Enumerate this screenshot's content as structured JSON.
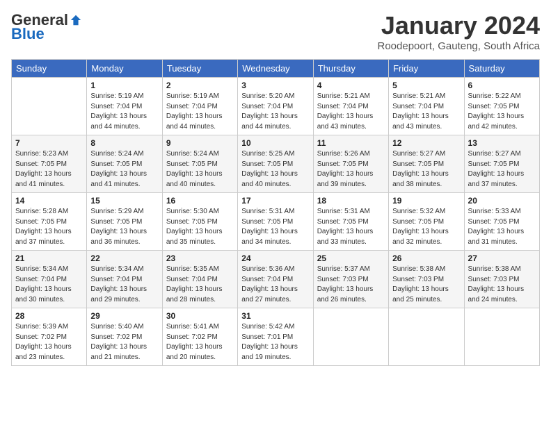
{
  "header": {
    "logo": {
      "general": "General",
      "blue": "Blue"
    },
    "title": "January 2024",
    "location": "Roodepoort, Gauteng, South Africa"
  },
  "weekdays": [
    "Sunday",
    "Monday",
    "Tuesday",
    "Wednesday",
    "Thursday",
    "Friday",
    "Saturday"
  ],
  "weeks": [
    [
      {
        "day": "",
        "info": ""
      },
      {
        "day": "1",
        "info": "Sunrise: 5:19 AM\nSunset: 7:04 PM\nDaylight: 13 hours\nand 44 minutes."
      },
      {
        "day": "2",
        "info": "Sunrise: 5:19 AM\nSunset: 7:04 PM\nDaylight: 13 hours\nand 44 minutes."
      },
      {
        "day": "3",
        "info": "Sunrise: 5:20 AM\nSunset: 7:04 PM\nDaylight: 13 hours\nand 44 minutes."
      },
      {
        "day": "4",
        "info": "Sunrise: 5:21 AM\nSunset: 7:04 PM\nDaylight: 13 hours\nand 43 minutes."
      },
      {
        "day": "5",
        "info": "Sunrise: 5:21 AM\nSunset: 7:04 PM\nDaylight: 13 hours\nand 43 minutes."
      },
      {
        "day": "6",
        "info": "Sunrise: 5:22 AM\nSunset: 7:05 PM\nDaylight: 13 hours\nand 42 minutes."
      }
    ],
    [
      {
        "day": "7",
        "info": "Sunrise: 5:23 AM\nSunset: 7:05 PM\nDaylight: 13 hours\nand 41 minutes."
      },
      {
        "day": "8",
        "info": "Sunrise: 5:24 AM\nSunset: 7:05 PM\nDaylight: 13 hours\nand 41 minutes."
      },
      {
        "day": "9",
        "info": "Sunrise: 5:24 AM\nSunset: 7:05 PM\nDaylight: 13 hours\nand 40 minutes."
      },
      {
        "day": "10",
        "info": "Sunrise: 5:25 AM\nSunset: 7:05 PM\nDaylight: 13 hours\nand 40 minutes."
      },
      {
        "day": "11",
        "info": "Sunrise: 5:26 AM\nSunset: 7:05 PM\nDaylight: 13 hours\nand 39 minutes."
      },
      {
        "day": "12",
        "info": "Sunrise: 5:27 AM\nSunset: 7:05 PM\nDaylight: 13 hours\nand 38 minutes."
      },
      {
        "day": "13",
        "info": "Sunrise: 5:27 AM\nSunset: 7:05 PM\nDaylight: 13 hours\nand 37 minutes."
      }
    ],
    [
      {
        "day": "14",
        "info": "Sunrise: 5:28 AM\nSunset: 7:05 PM\nDaylight: 13 hours\nand 37 minutes."
      },
      {
        "day": "15",
        "info": "Sunrise: 5:29 AM\nSunset: 7:05 PM\nDaylight: 13 hours\nand 36 minutes."
      },
      {
        "day": "16",
        "info": "Sunrise: 5:30 AM\nSunset: 7:05 PM\nDaylight: 13 hours\nand 35 minutes."
      },
      {
        "day": "17",
        "info": "Sunrise: 5:31 AM\nSunset: 7:05 PM\nDaylight: 13 hours\nand 34 minutes."
      },
      {
        "day": "18",
        "info": "Sunrise: 5:31 AM\nSunset: 7:05 PM\nDaylight: 13 hours\nand 33 minutes."
      },
      {
        "day": "19",
        "info": "Sunrise: 5:32 AM\nSunset: 7:05 PM\nDaylight: 13 hours\nand 32 minutes."
      },
      {
        "day": "20",
        "info": "Sunrise: 5:33 AM\nSunset: 7:05 PM\nDaylight: 13 hours\nand 31 minutes."
      }
    ],
    [
      {
        "day": "21",
        "info": "Sunrise: 5:34 AM\nSunset: 7:04 PM\nDaylight: 13 hours\nand 30 minutes."
      },
      {
        "day": "22",
        "info": "Sunrise: 5:34 AM\nSunset: 7:04 PM\nDaylight: 13 hours\nand 29 minutes."
      },
      {
        "day": "23",
        "info": "Sunrise: 5:35 AM\nSunset: 7:04 PM\nDaylight: 13 hours\nand 28 minutes."
      },
      {
        "day": "24",
        "info": "Sunrise: 5:36 AM\nSunset: 7:04 PM\nDaylight: 13 hours\nand 27 minutes."
      },
      {
        "day": "25",
        "info": "Sunrise: 5:37 AM\nSunset: 7:03 PM\nDaylight: 13 hours\nand 26 minutes."
      },
      {
        "day": "26",
        "info": "Sunrise: 5:38 AM\nSunset: 7:03 PM\nDaylight: 13 hours\nand 25 minutes."
      },
      {
        "day": "27",
        "info": "Sunrise: 5:38 AM\nSunset: 7:03 PM\nDaylight: 13 hours\nand 24 minutes."
      }
    ],
    [
      {
        "day": "28",
        "info": "Sunrise: 5:39 AM\nSunset: 7:02 PM\nDaylight: 13 hours\nand 23 minutes."
      },
      {
        "day": "29",
        "info": "Sunrise: 5:40 AM\nSunset: 7:02 PM\nDaylight: 13 hours\nand 21 minutes."
      },
      {
        "day": "30",
        "info": "Sunrise: 5:41 AM\nSunset: 7:02 PM\nDaylight: 13 hours\nand 20 minutes."
      },
      {
        "day": "31",
        "info": "Sunrise: 5:42 AM\nSunset: 7:01 PM\nDaylight: 13 hours\nand 19 minutes."
      },
      {
        "day": "",
        "info": ""
      },
      {
        "day": "",
        "info": ""
      },
      {
        "day": "",
        "info": ""
      }
    ]
  ]
}
